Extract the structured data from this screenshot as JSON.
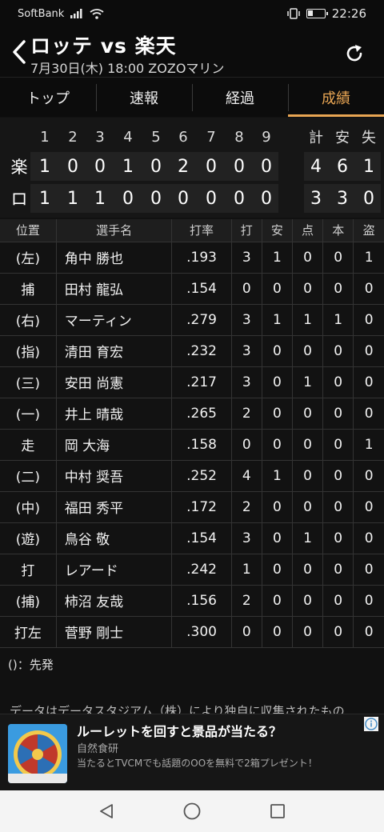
{
  "status_bar": {
    "carrier": "SoftBank",
    "time": "22:26"
  },
  "header": {
    "title": "ロッテ vs 楽天",
    "subtitle": "7月30日(木) 18:00 ZOZOマリン"
  },
  "tabs": [
    {
      "label": "トップ",
      "active": false
    },
    {
      "label": "速報",
      "active": false
    },
    {
      "label": "経過",
      "active": false
    },
    {
      "label": "成績",
      "active": true
    }
  ],
  "linescore": {
    "innings": [
      "1",
      "2",
      "3",
      "4",
      "5",
      "6",
      "7",
      "8",
      "9"
    ],
    "totals_headers": [
      "計",
      "安",
      "失"
    ],
    "teams": [
      {
        "abbr": "楽",
        "runs": [
          "1",
          "0",
          "0",
          "1",
          "0",
          "2",
          "0",
          "0",
          "0"
        ],
        "totals": [
          "4",
          "6",
          "1"
        ]
      },
      {
        "abbr": "ロ",
        "runs": [
          "1",
          "1",
          "1",
          "0",
          "0",
          "0",
          "0",
          "0",
          "0"
        ],
        "totals": [
          "3",
          "3",
          "0"
        ]
      }
    ]
  },
  "table": {
    "headers": [
      "位置",
      "選手名",
      "打率",
      "打",
      "安",
      "点",
      "本",
      "盗"
    ],
    "rows": [
      [
        "(左)",
        "角中 勝也",
        ".193",
        "3",
        "1",
        "0",
        "0",
        "1"
      ],
      [
        "捕",
        "田村 龍弘",
        ".154",
        "0",
        "0",
        "0",
        "0",
        "0"
      ],
      [
        "(右)",
        "マーティン",
        ".279",
        "3",
        "1",
        "1",
        "1",
        "0"
      ],
      [
        "(指)",
        "清田 育宏",
        ".232",
        "3",
        "0",
        "0",
        "0",
        "0"
      ],
      [
        "(三)",
        "安田 尚憲",
        ".217",
        "3",
        "0",
        "1",
        "0",
        "0"
      ],
      [
        "(一)",
        "井上 晴哉",
        ".265",
        "2",
        "0",
        "0",
        "0",
        "0"
      ],
      [
        "走",
        "岡 大海",
        ".158",
        "0",
        "0",
        "0",
        "0",
        "1"
      ],
      [
        "(二)",
        "中村 奨吾",
        ".252",
        "4",
        "1",
        "0",
        "0",
        "0"
      ],
      [
        "(中)",
        "福田 秀平",
        ".172",
        "2",
        "0",
        "0",
        "0",
        "0"
      ],
      [
        "(遊)",
        "鳥谷 敬",
        ".154",
        "3",
        "0",
        "1",
        "0",
        "0"
      ],
      [
        "打",
        "レアード",
        ".242",
        "1",
        "0",
        "0",
        "0",
        "0"
      ],
      [
        "(捕)",
        "柿沼 友哉",
        ".156",
        "2",
        "0",
        "0",
        "0",
        "0"
      ],
      [
        "打左",
        "菅野 剛士",
        ".300",
        "0",
        "0",
        "0",
        "0",
        "0"
      ]
    ]
  },
  "note": "()：先発",
  "footnote": "データはデータスタジアム（株）により独自に収集されたもの",
  "ad": {
    "title": "ルーレットを回すと景品が当たる？",
    "sponsor": "自然食研",
    "description": "当たるとTVCMでも話題のOOを無料で2箱プレゼント！"
  },
  "colors": {
    "accent": "#e8a553",
    "background": "#111111"
  }
}
